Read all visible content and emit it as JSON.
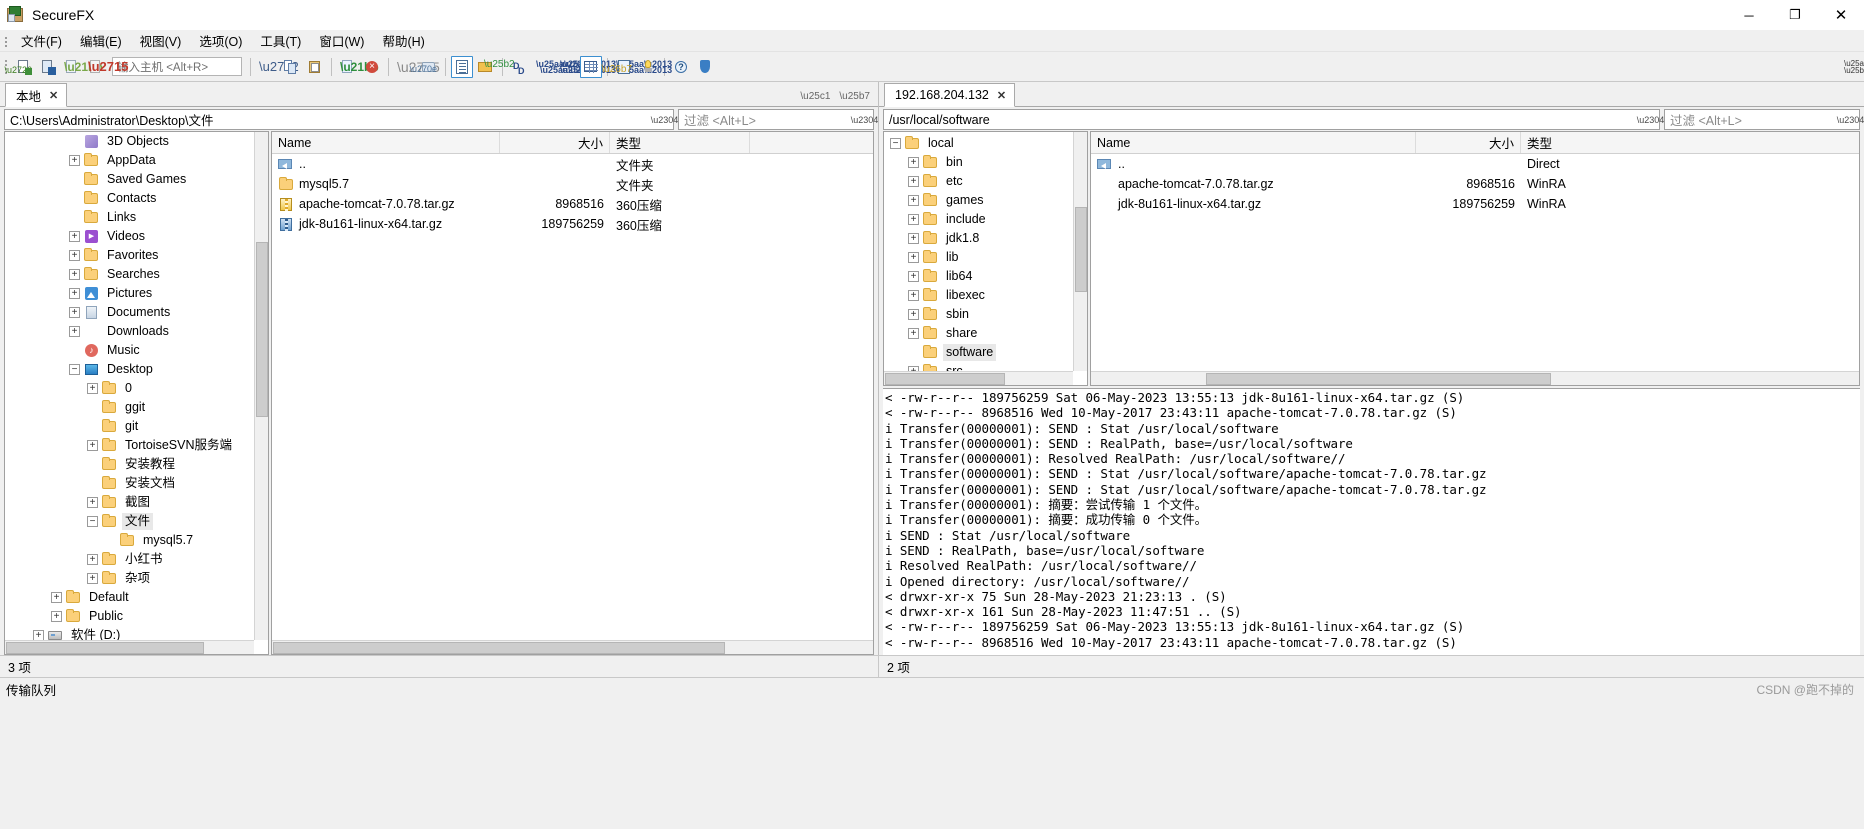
{
  "window": {
    "title": "SecureFX",
    "icon": "securefx-icon",
    "controls": {
      "minimize": "─",
      "maximize": "❐",
      "close": "✕"
    }
  },
  "menu": {
    "items": [
      {
        "label": "文件(F)",
        "name": "menu-file"
      },
      {
        "label": "编辑(E)",
        "name": "menu-edit"
      },
      {
        "label": "视图(V)",
        "name": "menu-view"
      },
      {
        "label": "选项(O)",
        "name": "menu-options"
      },
      {
        "label": "工具(T)",
        "name": "menu-tools"
      },
      {
        "label": "窗口(W)",
        "name": "menu-window"
      },
      {
        "label": "帮助(H)",
        "name": "menu-help"
      }
    ]
  },
  "toolbar": {
    "host_placeholder": "输入主机 <Alt+R>",
    "overflow": "»"
  },
  "local": {
    "tab": {
      "label": "本地",
      "close": "✕"
    },
    "path": "C:\\Users\\Administrator\\Desktop\\文件",
    "filter_placeholder": "过滤 <Alt+L>",
    "tree": [
      {
        "label": "3D Objects",
        "depth": 3,
        "expander": "none",
        "icon": "3d-objects-icon"
      },
      {
        "label": "AppData",
        "depth": 3,
        "expander": "plus",
        "icon": "folder-icon"
      },
      {
        "label": "Saved Games",
        "depth": 3,
        "expander": "none",
        "icon": "folder-icon"
      },
      {
        "label": "Contacts",
        "depth": 3,
        "expander": "none",
        "icon": "folder-icon"
      },
      {
        "label": "Links",
        "depth": 3,
        "expander": "none",
        "icon": "folder-icon"
      },
      {
        "label": "Videos",
        "depth": 3,
        "expander": "plus",
        "icon": "videos-icon"
      },
      {
        "label": "Favorites",
        "depth": 3,
        "expander": "plus",
        "icon": "folder-icon"
      },
      {
        "label": "Searches",
        "depth": 3,
        "expander": "plus",
        "icon": "folder-icon"
      },
      {
        "label": "Pictures",
        "depth": 3,
        "expander": "plus",
        "icon": "pictures-icon"
      },
      {
        "label": "Documents",
        "depth": 3,
        "expander": "plus",
        "icon": "documents-icon"
      },
      {
        "label": "Downloads",
        "depth": 3,
        "expander": "plus",
        "icon": "downloads-icon"
      },
      {
        "label": "Music",
        "depth": 3,
        "expander": "none",
        "icon": "music-icon"
      },
      {
        "label": "Desktop",
        "depth": 3,
        "expander": "minus",
        "icon": "desktop-icon"
      },
      {
        "label": "0",
        "depth": 4,
        "expander": "plus",
        "icon": "folder-icon"
      },
      {
        "label": "ggit",
        "depth": 4,
        "expander": "none",
        "icon": "folder-icon"
      },
      {
        "label": "git",
        "depth": 4,
        "expander": "none",
        "icon": "folder-icon"
      },
      {
        "label": "TortoiseSVN服务端",
        "depth": 4,
        "expander": "plus",
        "icon": "folder-icon"
      },
      {
        "label": "安装教程",
        "depth": 4,
        "expander": "none",
        "icon": "folder-icon"
      },
      {
        "label": "安装文档",
        "depth": 4,
        "expander": "none",
        "icon": "folder-icon"
      },
      {
        "label": "截图",
        "depth": 4,
        "expander": "plus",
        "icon": "folder-icon"
      },
      {
        "label": "文件",
        "depth": 4,
        "expander": "minus",
        "icon": "folder-icon",
        "selected": true
      },
      {
        "label": "mysql5.7",
        "depth": 5,
        "expander": "none",
        "icon": "folder-icon"
      },
      {
        "label": "小红书",
        "depth": 4,
        "expander": "plus",
        "icon": "folder-icon"
      },
      {
        "label": "杂项",
        "depth": 4,
        "expander": "plus",
        "icon": "folder-icon"
      },
      {
        "label": "Default",
        "depth": 2,
        "expander": "plus",
        "icon": "folder-icon"
      },
      {
        "label": "Public",
        "depth": 2,
        "expander": "plus",
        "icon": "folder-icon"
      },
      {
        "label": "软件 (D:)",
        "depth": 1,
        "expander": "plus",
        "icon": "drive-icon"
      }
    ],
    "columns": [
      {
        "label": "Name",
        "key": "name",
        "align": "left"
      },
      {
        "label": "大小",
        "key": "size",
        "align": "right"
      },
      {
        "label": "类型",
        "key": "type",
        "align": "left"
      }
    ],
    "rows": [
      {
        "name": "..",
        "size": "",
        "type": "文件夹",
        "icon": "parent-folder-icon"
      },
      {
        "name": "mysql5.7",
        "size": "",
        "type": "文件夹",
        "icon": "folder-icon"
      },
      {
        "name": "apache-tomcat-7.0.78.tar.gz",
        "size": "8968516",
        "type": "360压缩",
        "icon": "archive-icon"
      },
      {
        "name": "jdk-8u161-linux-x64.tar.gz",
        "size": "189756259",
        "type": "360压缩",
        "icon": "archive-blue-icon"
      }
    ],
    "status": "3 项"
  },
  "remote": {
    "tab": {
      "label": "192.168.204.132",
      "close": "✕"
    },
    "path": "/usr/local/software",
    "filter_placeholder": "过滤 <Alt+L>",
    "tree": [
      {
        "label": "local",
        "depth": 1,
        "expander": "minus",
        "icon": "folder-icon"
      },
      {
        "label": "bin",
        "depth": 2,
        "expander": "plus",
        "icon": "folder-icon"
      },
      {
        "label": "etc",
        "depth": 2,
        "expander": "plus",
        "icon": "folder-icon"
      },
      {
        "label": "games",
        "depth": 2,
        "expander": "plus",
        "icon": "folder-icon"
      },
      {
        "label": "include",
        "depth": 2,
        "expander": "plus",
        "icon": "folder-icon"
      },
      {
        "label": "jdk1.8",
        "depth": 2,
        "expander": "plus",
        "icon": "folder-icon"
      },
      {
        "label": "lib",
        "depth": 2,
        "expander": "plus",
        "icon": "folder-icon"
      },
      {
        "label": "lib64",
        "depth": 2,
        "expander": "plus",
        "icon": "folder-icon"
      },
      {
        "label": "libexec",
        "depth": 2,
        "expander": "plus",
        "icon": "folder-icon"
      },
      {
        "label": "sbin",
        "depth": 2,
        "expander": "plus",
        "icon": "folder-icon"
      },
      {
        "label": "share",
        "depth": 2,
        "expander": "plus",
        "icon": "folder-icon"
      },
      {
        "label": "software",
        "depth": 2,
        "expander": "none",
        "icon": "folder-icon",
        "selected": true
      },
      {
        "label": "src",
        "depth": 2,
        "expander": "plus",
        "icon": "folder-icon"
      }
    ],
    "columns": [
      {
        "label": "Name",
        "key": "name",
        "align": "left"
      },
      {
        "label": "大小",
        "key": "size",
        "align": "right"
      },
      {
        "label": "类型",
        "key": "type",
        "align": "left"
      }
    ],
    "rows": [
      {
        "name": "..",
        "size": "",
        "type": "Direct",
        "icon": "parent-folder-icon"
      },
      {
        "name": "apache-tomcat-7.0.78.tar.gz",
        "size": "8968516",
        "type": "WinRA",
        "icon": "none"
      },
      {
        "name": "jdk-8u161-linux-x64.tar.gz",
        "size": "189756259",
        "type": "WinRA",
        "icon": "none"
      }
    ],
    "status": "2 项"
  },
  "log": {
    "lines": [
      "< -rw-r--r--  189756259 Sat 06-May-2023 13:55:13 jdk-8u161-linux-x64.tar.gz (S)",
      "< -rw-r--r--    8968516 Wed 10-May-2017 23:43:11 apache-tomcat-7.0.78.tar.gz (S)",
      "i Transfer(00000001): SEND : Stat /usr/local/software",
      "i Transfer(00000001): SEND : RealPath, base=/usr/local/software",
      "i Transfer(00000001): Resolved RealPath: /usr/local/software//",
      "i Transfer(00000001): SEND : Stat /usr/local/software/apache-tomcat-7.0.78.tar.gz",
      "i Transfer(00000001): SEND : Stat /usr/local/software/apache-tomcat-7.0.78.tar.gz",
      "i Transfer(00000001): 摘要：尝试传输 1 个文件。",
      "i Transfer(00000001): 摘要：成功传输 0 个文件。",
      "i SEND : Stat /usr/local/software",
      "i SEND : RealPath, base=/usr/local/software",
      "i Resolved RealPath: /usr/local/software//",
      "i Opened directory: /usr/local/software//",
      "< drwxr-xr-x         75 Sun 28-May-2023 21:23:13 . (S)",
      "< drwxr-xr-x        161 Sun 28-May-2023 11:47:51 .. (S)",
      "< -rw-r--r--  189756259 Sat 06-May-2023 13:55:13 jdk-8u161-linux-x64.tar.gz (S)",
      "< -rw-r--r--    8968516 Wed 10-May-2017 23:43:11 apache-tomcat-7.0.78.tar.gz (S)"
    ]
  },
  "bottom": {
    "queue_label": "传输队列",
    "watermark": "CSDN @跑不掉的"
  },
  "colors": {
    "accent": "#3c8fd0",
    "folder": "#fbd07a",
    "window_bg": "#f0f0f0"
  }
}
